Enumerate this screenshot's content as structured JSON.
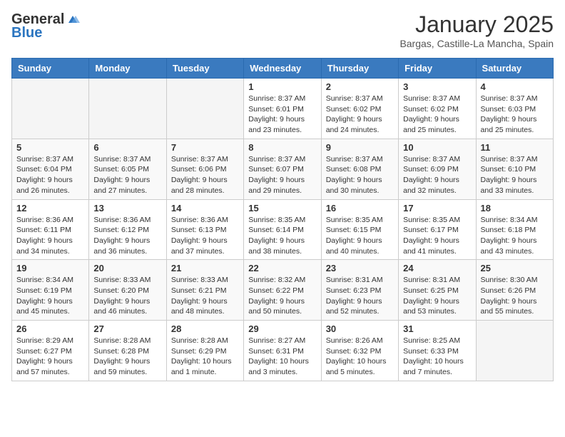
{
  "header": {
    "logo_general": "General",
    "logo_blue": "Blue",
    "title": "January 2025",
    "location": "Bargas, Castille-La Mancha, Spain"
  },
  "weekdays": [
    "Sunday",
    "Monday",
    "Tuesday",
    "Wednesday",
    "Thursday",
    "Friday",
    "Saturday"
  ],
  "weeks": [
    [
      {
        "day": "",
        "info": ""
      },
      {
        "day": "",
        "info": ""
      },
      {
        "day": "",
        "info": ""
      },
      {
        "day": "1",
        "info": "Sunrise: 8:37 AM\nSunset: 6:01 PM\nDaylight: 9 hours\nand 23 minutes."
      },
      {
        "day": "2",
        "info": "Sunrise: 8:37 AM\nSunset: 6:02 PM\nDaylight: 9 hours\nand 24 minutes."
      },
      {
        "day": "3",
        "info": "Sunrise: 8:37 AM\nSunset: 6:02 PM\nDaylight: 9 hours\nand 25 minutes."
      },
      {
        "day": "4",
        "info": "Sunrise: 8:37 AM\nSunset: 6:03 PM\nDaylight: 9 hours\nand 25 minutes."
      }
    ],
    [
      {
        "day": "5",
        "info": "Sunrise: 8:37 AM\nSunset: 6:04 PM\nDaylight: 9 hours\nand 26 minutes."
      },
      {
        "day": "6",
        "info": "Sunrise: 8:37 AM\nSunset: 6:05 PM\nDaylight: 9 hours\nand 27 minutes."
      },
      {
        "day": "7",
        "info": "Sunrise: 8:37 AM\nSunset: 6:06 PM\nDaylight: 9 hours\nand 28 minutes."
      },
      {
        "day": "8",
        "info": "Sunrise: 8:37 AM\nSunset: 6:07 PM\nDaylight: 9 hours\nand 29 minutes."
      },
      {
        "day": "9",
        "info": "Sunrise: 8:37 AM\nSunset: 6:08 PM\nDaylight: 9 hours\nand 30 minutes."
      },
      {
        "day": "10",
        "info": "Sunrise: 8:37 AM\nSunset: 6:09 PM\nDaylight: 9 hours\nand 32 minutes."
      },
      {
        "day": "11",
        "info": "Sunrise: 8:37 AM\nSunset: 6:10 PM\nDaylight: 9 hours\nand 33 minutes."
      }
    ],
    [
      {
        "day": "12",
        "info": "Sunrise: 8:36 AM\nSunset: 6:11 PM\nDaylight: 9 hours\nand 34 minutes."
      },
      {
        "day": "13",
        "info": "Sunrise: 8:36 AM\nSunset: 6:12 PM\nDaylight: 9 hours\nand 36 minutes."
      },
      {
        "day": "14",
        "info": "Sunrise: 8:36 AM\nSunset: 6:13 PM\nDaylight: 9 hours\nand 37 minutes."
      },
      {
        "day": "15",
        "info": "Sunrise: 8:35 AM\nSunset: 6:14 PM\nDaylight: 9 hours\nand 38 minutes."
      },
      {
        "day": "16",
        "info": "Sunrise: 8:35 AM\nSunset: 6:15 PM\nDaylight: 9 hours\nand 40 minutes."
      },
      {
        "day": "17",
        "info": "Sunrise: 8:35 AM\nSunset: 6:17 PM\nDaylight: 9 hours\nand 41 minutes."
      },
      {
        "day": "18",
        "info": "Sunrise: 8:34 AM\nSunset: 6:18 PM\nDaylight: 9 hours\nand 43 minutes."
      }
    ],
    [
      {
        "day": "19",
        "info": "Sunrise: 8:34 AM\nSunset: 6:19 PM\nDaylight: 9 hours\nand 45 minutes."
      },
      {
        "day": "20",
        "info": "Sunrise: 8:33 AM\nSunset: 6:20 PM\nDaylight: 9 hours\nand 46 minutes."
      },
      {
        "day": "21",
        "info": "Sunrise: 8:33 AM\nSunset: 6:21 PM\nDaylight: 9 hours\nand 48 minutes."
      },
      {
        "day": "22",
        "info": "Sunrise: 8:32 AM\nSunset: 6:22 PM\nDaylight: 9 hours\nand 50 minutes."
      },
      {
        "day": "23",
        "info": "Sunrise: 8:31 AM\nSunset: 6:23 PM\nDaylight: 9 hours\nand 52 minutes."
      },
      {
        "day": "24",
        "info": "Sunrise: 8:31 AM\nSunset: 6:25 PM\nDaylight: 9 hours\nand 53 minutes."
      },
      {
        "day": "25",
        "info": "Sunrise: 8:30 AM\nSunset: 6:26 PM\nDaylight: 9 hours\nand 55 minutes."
      }
    ],
    [
      {
        "day": "26",
        "info": "Sunrise: 8:29 AM\nSunset: 6:27 PM\nDaylight: 9 hours\nand 57 minutes."
      },
      {
        "day": "27",
        "info": "Sunrise: 8:28 AM\nSunset: 6:28 PM\nDaylight: 9 hours\nand 59 minutes."
      },
      {
        "day": "28",
        "info": "Sunrise: 8:28 AM\nSunset: 6:29 PM\nDaylight: 10 hours\nand 1 minute."
      },
      {
        "day": "29",
        "info": "Sunrise: 8:27 AM\nSunset: 6:31 PM\nDaylight: 10 hours\nand 3 minutes."
      },
      {
        "day": "30",
        "info": "Sunrise: 8:26 AM\nSunset: 6:32 PM\nDaylight: 10 hours\nand 5 minutes."
      },
      {
        "day": "31",
        "info": "Sunrise: 8:25 AM\nSunset: 6:33 PM\nDaylight: 10 hours\nand 7 minutes."
      },
      {
        "day": "",
        "info": ""
      }
    ]
  ]
}
